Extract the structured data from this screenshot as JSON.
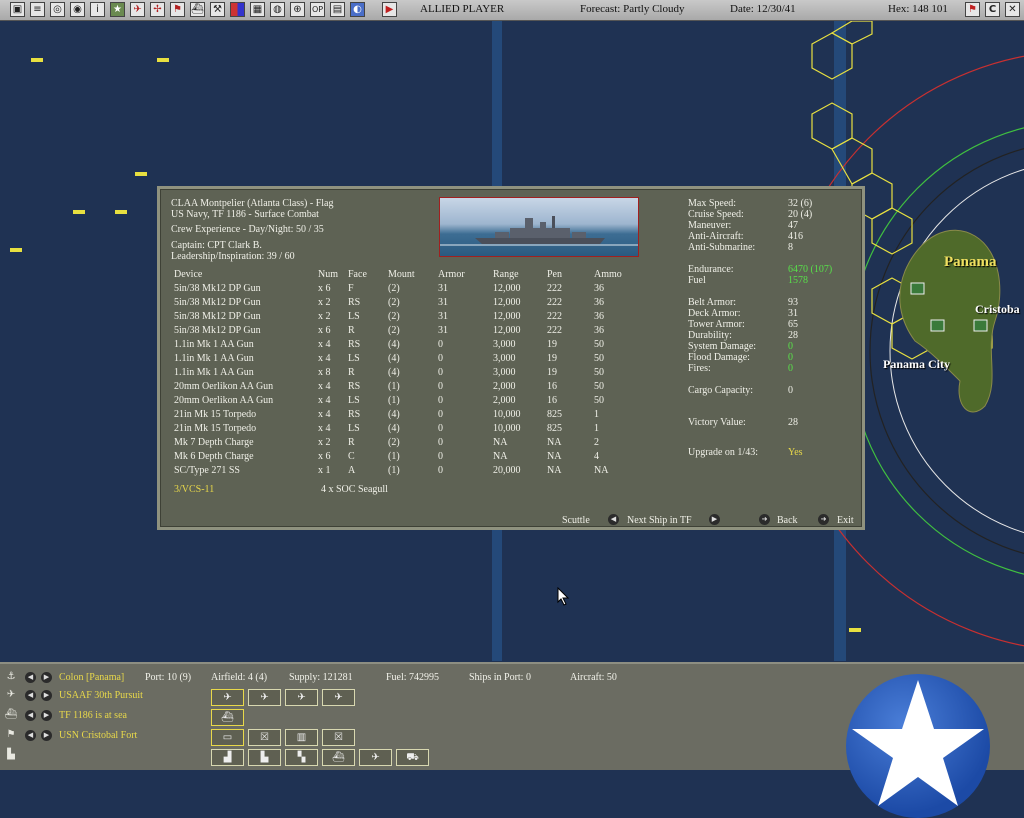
{
  "topbar": {
    "icons": [
      "square-icon",
      "doc-icon",
      "globe-icon",
      "globe2-icon",
      "info-icon",
      "star-icon",
      "plane-icon",
      "plane2-icon",
      "flag-icon",
      "ship-icon",
      "tools-icon",
      "color-icon",
      "chart-icon",
      "map-icon",
      "globe3-icon",
      "op-icon",
      "list-icon",
      "settings-icon",
      "play-icon"
    ],
    "player": "ALLIED PLAYER",
    "forecast": "Forecast: Partly Cloudy",
    "date": "Date: 12/30/41",
    "hex": "Hex: 148 101",
    "right_icons": [
      "flag-red-icon",
      "c-icon",
      "close-icon"
    ]
  },
  "map": {
    "labels": {
      "panama": "Panama",
      "cristobal": "Cristoba",
      "panama_city": "Panama City"
    }
  },
  "ship": {
    "name": "CLAA Montpelier (Atlanta Class) - Flag",
    "service": "US Navy, TF 1186 - Surface Combat",
    "crew": "Crew Experience - Day/Night: 50 / 35",
    "captain": "Captain: CPT Clark B.",
    "leadership": "Leadership/Inspiration: 39 / 60"
  },
  "devices": {
    "headers": [
      "Device",
      "Num",
      "Face",
      "Mount",
      "Armor",
      "Range",
      "Pen",
      "Ammo"
    ],
    "rows": [
      [
        "5in/38 Mk12 DP Gun",
        "x 6",
        "F",
        "(2)",
        "31",
        "12,000",
        "222",
        "36"
      ],
      [
        "5in/38 Mk12 DP Gun",
        "x 2",
        "RS",
        "(2)",
        "31",
        "12,000",
        "222",
        "36"
      ],
      [
        "5in/38 Mk12 DP Gun",
        "x 2",
        "LS",
        "(2)",
        "31",
        "12,000",
        "222",
        "36"
      ],
      [
        "5in/38 Mk12 DP Gun",
        "x 6",
        "R",
        "(2)",
        "31",
        "12,000",
        "222",
        "36"
      ],
      [
        "1.1in Mk 1 AA Gun",
        "x 4",
        "RS",
        "(4)",
        "0",
        "3,000",
        "19",
        "50"
      ],
      [
        "1.1in Mk 1 AA Gun",
        "x 4",
        "LS",
        "(4)",
        "0",
        "3,000",
        "19",
        "50"
      ],
      [
        "1.1in Mk 1 AA Gun",
        "x 8",
        "R",
        "(4)",
        "0",
        "3,000",
        "19",
        "50"
      ],
      [
        "20mm Oerlikon AA Gun",
        "x 4",
        "RS",
        "(1)",
        "0",
        "2,000",
        "16",
        "50"
      ],
      [
        "20mm Oerlikon AA Gun",
        "x 4",
        "LS",
        "(1)",
        "0",
        "2,000",
        "16",
        "50"
      ],
      [
        "21in Mk 15 Torpedo",
        "x 4",
        "RS",
        "(4)",
        "0",
        "10,000",
        "825",
        "1"
      ],
      [
        "21in Mk 15 Torpedo",
        "x 4",
        "LS",
        "(4)",
        "0",
        "10,000",
        "825",
        "1"
      ],
      [
        "Mk 7 Depth Charge",
        "x 2",
        "R",
        "(2)",
        "0",
        "NA",
        "NA",
        "2"
      ],
      [
        "Mk 6 Depth Charge",
        "x 6",
        "C",
        "(1)",
        "0",
        "NA",
        "NA",
        "4"
      ],
      [
        "SC/Type 271 SS",
        "x 1",
        "A",
        "(1)",
        "0",
        "20,000",
        "NA",
        "NA"
      ]
    ],
    "air_group": "3/VCS-11",
    "air_group_count": "4 x SOC Seagull"
  },
  "stats": {
    "max_speed_label": "Max Speed:",
    "max_speed": "32 (6)",
    "cruise_speed_label": "Cruise Speed:",
    "cruise_speed": "20 (4)",
    "maneuver_label": "Maneuver:",
    "maneuver": "47",
    "aa_label": "Anti-Aircraft:",
    "aa": "416",
    "as_label": "Anti-Submarine:",
    "as": "8",
    "endurance_label": "Endurance:",
    "endurance": "6470 (107)",
    "fuel_label": "Fuel",
    "fuel": "1578",
    "belt_label": "Belt Armor:",
    "belt": "93",
    "deck_label": "Deck Armor:",
    "deck": "31",
    "tower_label": "Tower Armor:",
    "tower": "65",
    "durability_label": "Durability:",
    "durability": "28",
    "sysdmg_label": "System Damage:",
    "sysdmg": "0",
    "flooddmg_label": "Flood Damage:",
    "flooddmg": "0",
    "fires_label": "Fires:",
    "fires": "0",
    "cargo_label": "Cargo Capacity:",
    "cargo": "0",
    "victory_label": "Victory Value:",
    "victory": "28",
    "upgrade_label": "Upgrade on 1/43:",
    "upgrade": "Yes"
  },
  "buttons": {
    "scuttle": "Scuttle",
    "next_ship": "Next Ship in TF",
    "back": "Back",
    "exit": "Exit"
  },
  "bottom": {
    "base": "Colon [Panama]",
    "port": "Port: 10 (9)",
    "airfield": "Airfield: 4 (4)",
    "supply": "Supply: 121281",
    "fuel": "Fuel: 742995",
    "ships_in_port": "Ships in Port: 0",
    "aircraft": "Aircraft: 50",
    "air_unit": "USAAF 30th Pursuit",
    "tf": "TF 1186 is at sea",
    "land_unit": "USN Cristobal Fort"
  },
  "colors": {
    "ocean": "#1f3253",
    "panel": "#5e6254",
    "yellow_text": "#e8d84a",
    "green_text": "#58e04a"
  }
}
